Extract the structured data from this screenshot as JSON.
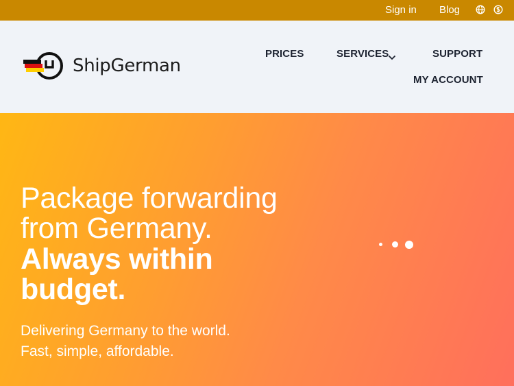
{
  "topbar": {
    "signin_label": "Sign in",
    "blog_label": "Blog",
    "language_icon": "globe-icon",
    "currency_icon": "currency-icon"
  },
  "header": {
    "brand_name": "ShipGerman",
    "logo_icon": "germany-flag-package-icon",
    "nav": {
      "prices": "PRICES",
      "services": "SERVICES",
      "support": "SUPPORT",
      "my_account": "MY ACCOUNT"
    }
  },
  "hero": {
    "headline_line1": "Package forwarding",
    "headline_line2": "from Germany.",
    "headline_bold_line1": "Always within",
    "headline_bold_line2": "budget.",
    "subline1": "Delivering Germany to the world.",
    "subline2": "Fast, simple, affordable.",
    "carousel_dot_count": 3
  },
  "colors": {
    "topbar_bg": "#c98800",
    "header_bg": "#f0f3f8",
    "hero_gradient_start": "#ffb714",
    "hero_gradient_end": "#ff6f5c",
    "text_dark": "#1c2230"
  }
}
